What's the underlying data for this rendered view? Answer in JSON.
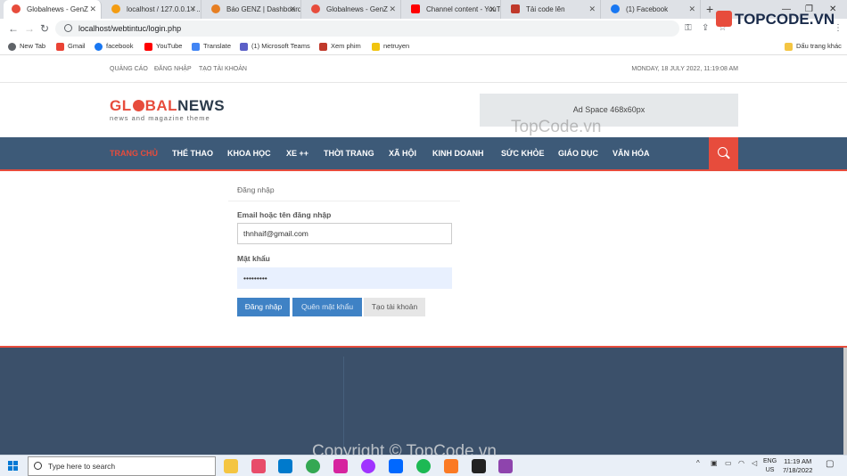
{
  "browser": {
    "tabs": [
      {
        "label": "Globalnews - GenZ",
        "color": "#e74c3c"
      },
      {
        "label": "localhost / 127.0.0.1 / ...",
        "color": "#f39c12"
      },
      {
        "label": "Báo GENZ | Dashboard",
        "color": "#e67e22"
      },
      {
        "label": "Globalnews - GenZ",
        "color": "#e74c3c"
      },
      {
        "label": "Channel content - YouTube",
        "color": "#ff0000"
      },
      {
        "label": "Tải code lên",
        "color": "#c0392b"
      },
      {
        "label": "(1) Facebook",
        "color": "#1877f2"
      }
    ],
    "url": "localhost/webtintuc/login.php",
    "bookmarks": [
      {
        "label": "New Tab",
        "color": "#5f6368"
      },
      {
        "label": "Gmail",
        "color": "#ea4335"
      },
      {
        "label": "facebook",
        "color": "#1877f2"
      },
      {
        "label": "YouTube",
        "color": "#ff0000"
      },
      {
        "label": "Translate",
        "color": "#4285f4"
      },
      {
        "label": "(1) Microsoft Teams",
        "color": "#5b5fc7"
      },
      {
        "label": "Xem phim",
        "color": "#c0392b"
      },
      {
        "label": "netruyen",
        "color": "#f1c40f"
      }
    ],
    "other_bookmarks": "Dấu trang khác"
  },
  "site": {
    "top_links": [
      "QUẢNG CÁO",
      "ĐĂNG NHẬP",
      "TẠO TÀI KHOẢN"
    ],
    "date": "MONDAY, 18 JULY 2022, 11:19:08 AM",
    "logo_part1": "GL",
    "logo_part2": "BAL",
    "logo_part3": "NEWS",
    "tagline": "news and magazine theme",
    "ad_text": "Ad Space 468x60px",
    "nav": [
      "TRANG CHỦ",
      "THỂ THAO",
      "KHOA HỌC",
      "XE ++",
      "THỜI TRANG",
      "XÃ HỘI",
      "KINH DOANH",
      "SỨC KHỎE",
      "GIÁO DỤC",
      "VĂN HÓA"
    ],
    "accent": "#e74c3c",
    "nav_bg": "#3d5a78"
  },
  "login": {
    "heading": "Đăng nhập",
    "email_label": "Email hoặc tên đăng nhập",
    "email_value": "thnhaif@gmail.com",
    "password_label": "Mật khẩu",
    "password_value": "•••••••••",
    "login_button": "Đăng nhập",
    "forgot_button": "Quên mật khẩu",
    "register_button": "Tạo tài khoản"
  },
  "watermarks": {
    "center": "TopCode.vn",
    "bottom": "Copyright © TopCode.vn",
    "brand": "TOPCODE.VN"
  },
  "taskbar": {
    "search_placeholder": "Type here to search",
    "lang": "ENG",
    "region": "US",
    "time": "11:19 AM",
    "date": "7/18/2022"
  }
}
